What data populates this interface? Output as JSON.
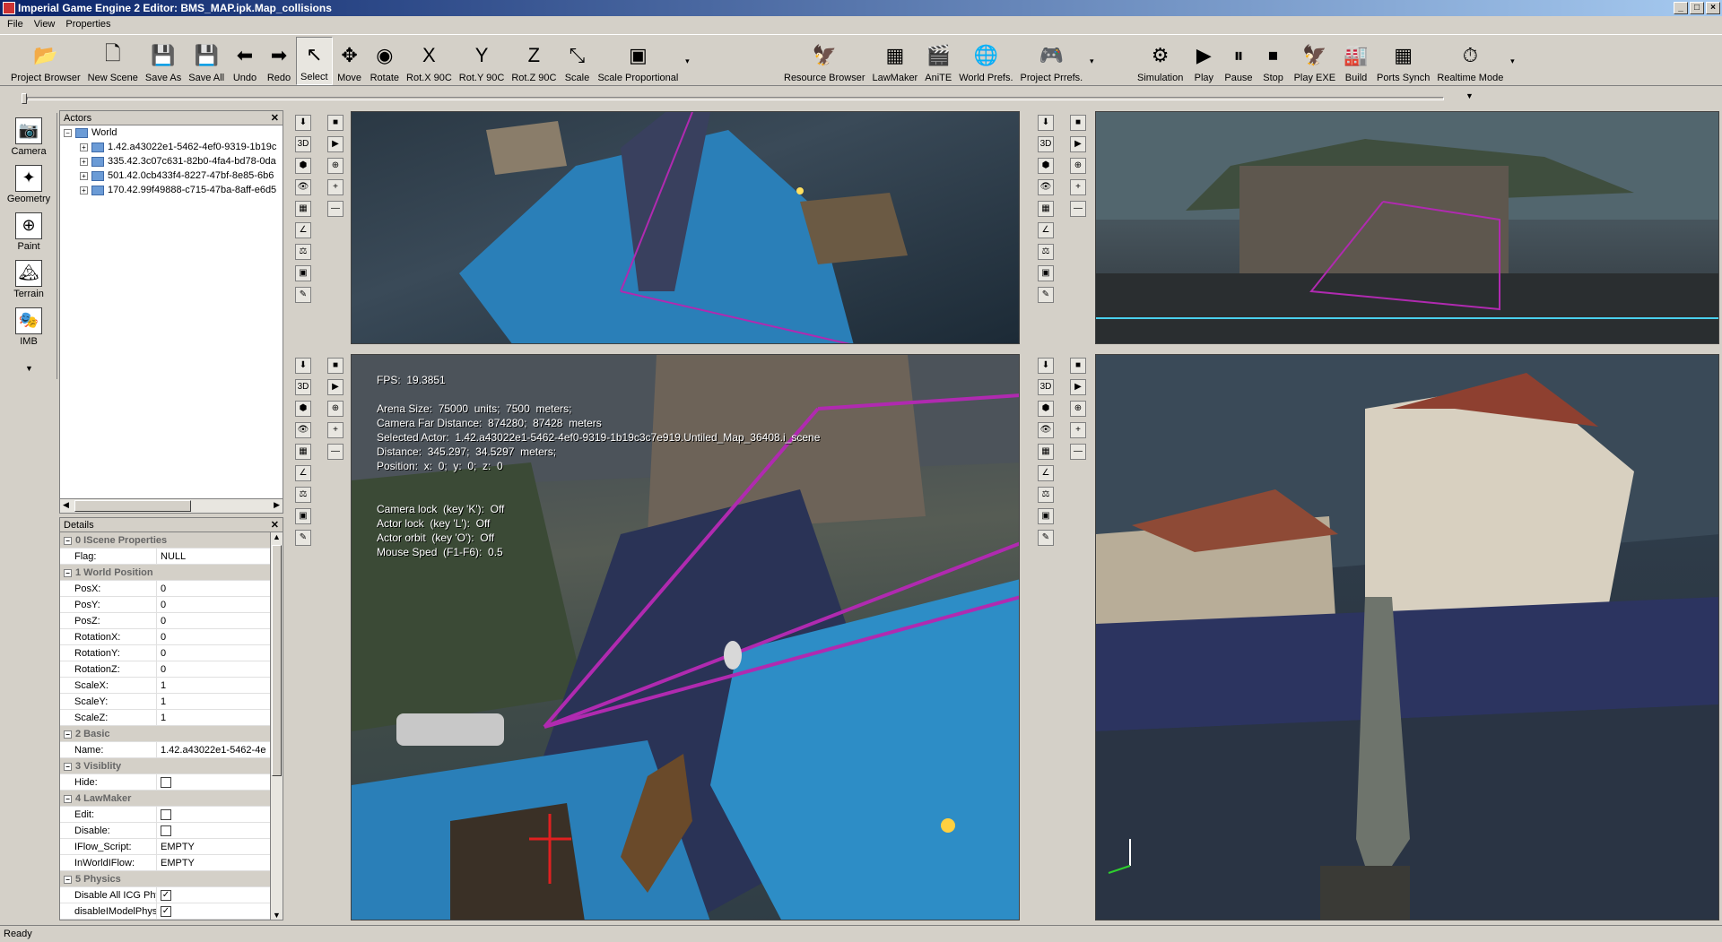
{
  "window": {
    "title": "Imperial Game Engine 2 Editor: BMS_MAP.ipk.Map_collisions",
    "controls": [
      "_",
      "□",
      "×"
    ]
  },
  "menu": [
    "File",
    "View",
    "Properties"
  ],
  "toolbar": {
    "group1": [
      {
        "label": "Project Browser",
        "icon": "folder-open-icon",
        "glyph": "📂"
      },
      {
        "label": "New Scene",
        "icon": "new-document-icon",
        "glyph": "🗋"
      },
      {
        "label": "Save As",
        "icon": "floppy-icon",
        "glyph": "💾"
      },
      {
        "label": "Save All",
        "icon": "floppy-stack-icon",
        "glyph": "💾"
      },
      {
        "label": "Undo",
        "icon": "arrow-left-icon",
        "glyph": "⬅"
      },
      {
        "label": "Redo",
        "icon": "arrow-right-icon",
        "glyph": "➡"
      },
      {
        "label": "Select",
        "icon": "cursor-icon",
        "glyph": "↖"
      },
      {
        "label": "Move",
        "icon": "move-cross-icon",
        "glyph": "✥"
      },
      {
        "label": "Rotate",
        "icon": "rotate-icon",
        "glyph": "◉"
      },
      {
        "label": "Rot.X 90C",
        "icon": "rot-x-icon",
        "glyph": "X"
      },
      {
        "label": "Rot.Y 90C",
        "icon": "rot-y-icon",
        "glyph": "Y"
      },
      {
        "label": "Rot.Z 90C",
        "icon": "rot-z-icon",
        "glyph": "Z"
      },
      {
        "label": "Scale",
        "icon": "scale-icon",
        "glyph": "⤡"
      },
      {
        "label": "Scale Proportional",
        "icon": "scale-proportional-icon",
        "glyph": "▣"
      }
    ],
    "group2": [
      {
        "label": "Resource Browser",
        "icon": "eagle-icon",
        "glyph": "🦅"
      },
      {
        "label": "LawMaker",
        "icon": "lawmaker-icon",
        "glyph": "▦"
      },
      {
        "label": "AniTE",
        "icon": "clapper-icon",
        "glyph": "🎬"
      },
      {
        "label": "World Prefs.",
        "icon": "globe-icon",
        "glyph": "🌐"
      },
      {
        "label": "Project Prrefs.",
        "icon": "gamepad-icon",
        "glyph": "🎮"
      }
    ],
    "group3": [
      {
        "label": "Simulation",
        "icon": "gear-icon",
        "glyph": "⚙"
      },
      {
        "label": "Play",
        "icon": "play-runner-icon",
        "glyph": "▶"
      },
      {
        "label": "Pause",
        "icon": "pause-icon",
        "glyph": "⏸"
      },
      {
        "label": "Stop",
        "icon": "stop-icon",
        "glyph": "⏹"
      },
      {
        "label": "Play EXE",
        "icon": "eagle-play-icon",
        "glyph": "🦅"
      },
      {
        "label": "Build",
        "icon": "build-icon",
        "glyph": "🏭"
      },
      {
        "label": "Ports Synch",
        "icon": "ports-synch-icon",
        "glyph": "▦"
      },
      {
        "label": "Realtime Mode",
        "icon": "stopwatch-icon",
        "glyph": "⏱"
      }
    ]
  },
  "left_tools": [
    {
      "label": "Camera",
      "icon": "camera-icon",
      "glyph": "📷"
    },
    {
      "label": "Geometry",
      "icon": "geometry-icon",
      "glyph": "✦"
    },
    {
      "label": "Paint",
      "icon": "paint-plus-icon",
      "glyph": "⊕"
    },
    {
      "label": "Terrain",
      "icon": "terrain-icon",
      "glyph": "🏔"
    },
    {
      "label": "IMB",
      "icon": "masks-icon",
      "glyph": "🎭"
    }
  ],
  "actors": {
    "title": "Actors",
    "root": "World",
    "items": [
      "1.42.a43022e1-5462-4ef0-9319-1b19c",
      "335.42.3c07c631-82b0-4fa4-bd78-0da",
      "501.42.0cb433f4-8227-47bf-8e85-6b6",
      "170.42.99f49888-c715-47ba-8aff-e6d5"
    ]
  },
  "details": {
    "title": "Details",
    "rows": [
      {
        "type": "cat",
        "name": "0 IScene Properties"
      },
      {
        "type": "prop",
        "name": "Flag:",
        "value": "NULL"
      },
      {
        "type": "cat",
        "name": "1 World Position"
      },
      {
        "type": "prop",
        "name": "PosX:",
        "value": "0"
      },
      {
        "type": "prop",
        "name": "PosY:",
        "value": "0"
      },
      {
        "type": "prop",
        "name": "PosZ:",
        "value": "0"
      },
      {
        "type": "prop",
        "name": "RotationX:",
        "value": "0"
      },
      {
        "type": "prop",
        "name": "RotationY:",
        "value": "0"
      },
      {
        "type": "prop",
        "name": "RotationZ:",
        "value": "0"
      },
      {
        "type": "prop",
        "name": "ScaleX:",
        "value": "1"
      },
      {
        "type": "prop",
        "name": "ScaleY:",
        "value": "1"
      },
      {
        "type": "prop",
        "name": "ScaleZ:",
        "value": "1"
      },
      {
        "type": "cat",
        "name": "2 Basic"
      },
      {
        "type": "prop",
        "name": "Name:",
        "value": "1.42.a43022e1-5462-4e"
      },
      {
        "type": "cat",
        "name": "3 Visiblity"
      },
      {
        "type": "check",
        "name": "Hide:",
        "checked": false
      },
      {
        "type": "cat",
        "name": "4 LawMaker"
      },
      {
        "type": "check",
        "name": "Edit:",
        "checked": false
      },
      {
        "type": "check",
        "name": "Disable:",
        "checked": false
      },
      {
        "type": "prop",
        "name": "IFlow_Script:",
        "value": "EMPTY"
      },
      {
        "type": "prop",
        "name": "InWorldIFlow:",
        "value": "EMPTY"
      },
      {
        "type": "cat",
        "name": "5 Physics"
      },
      {
        "type": "check",
        "name": "Disable All ICG Phy",
        "checked": true
      },
      {
        "type": "check",
        "name": "disableIModelPhysi",
        "checked": true
      }
    ]
  },
  "viewport_tools": [
    "3D",
    "▾",
    "⬢",
    "👁",
    "▦",
    "∠",
    "⚖",
    "▣",
    "✎"
  ],
  "overlay": {
    "fps": "FPS:  19.3851",
    "lines": [
      "Arena Size:  75000  units;  7500  meters;",
      "Camera Far Distance:  874280;  87428  meters",
      "Selected Actor:  1.42.a43022e1-5462-4ef0-9319-1b19c3c7e919.Untiled_Map_36408.i_scene",
      "Distance:  345.297;  34.5297  meters;",
      "Position:  x:  0;  y:  0;  z:  0"
    ],
    "locks": [
      "Camera lock  (key 'K'):  Off",
      "Actor lock  (key 'L'):  Off",
      "Actor orbit  (key 'O'):  Off",
      "Mouse Sped  (F1-F6):  0.5"
    ]
  },
  "status": "Ready"
}
